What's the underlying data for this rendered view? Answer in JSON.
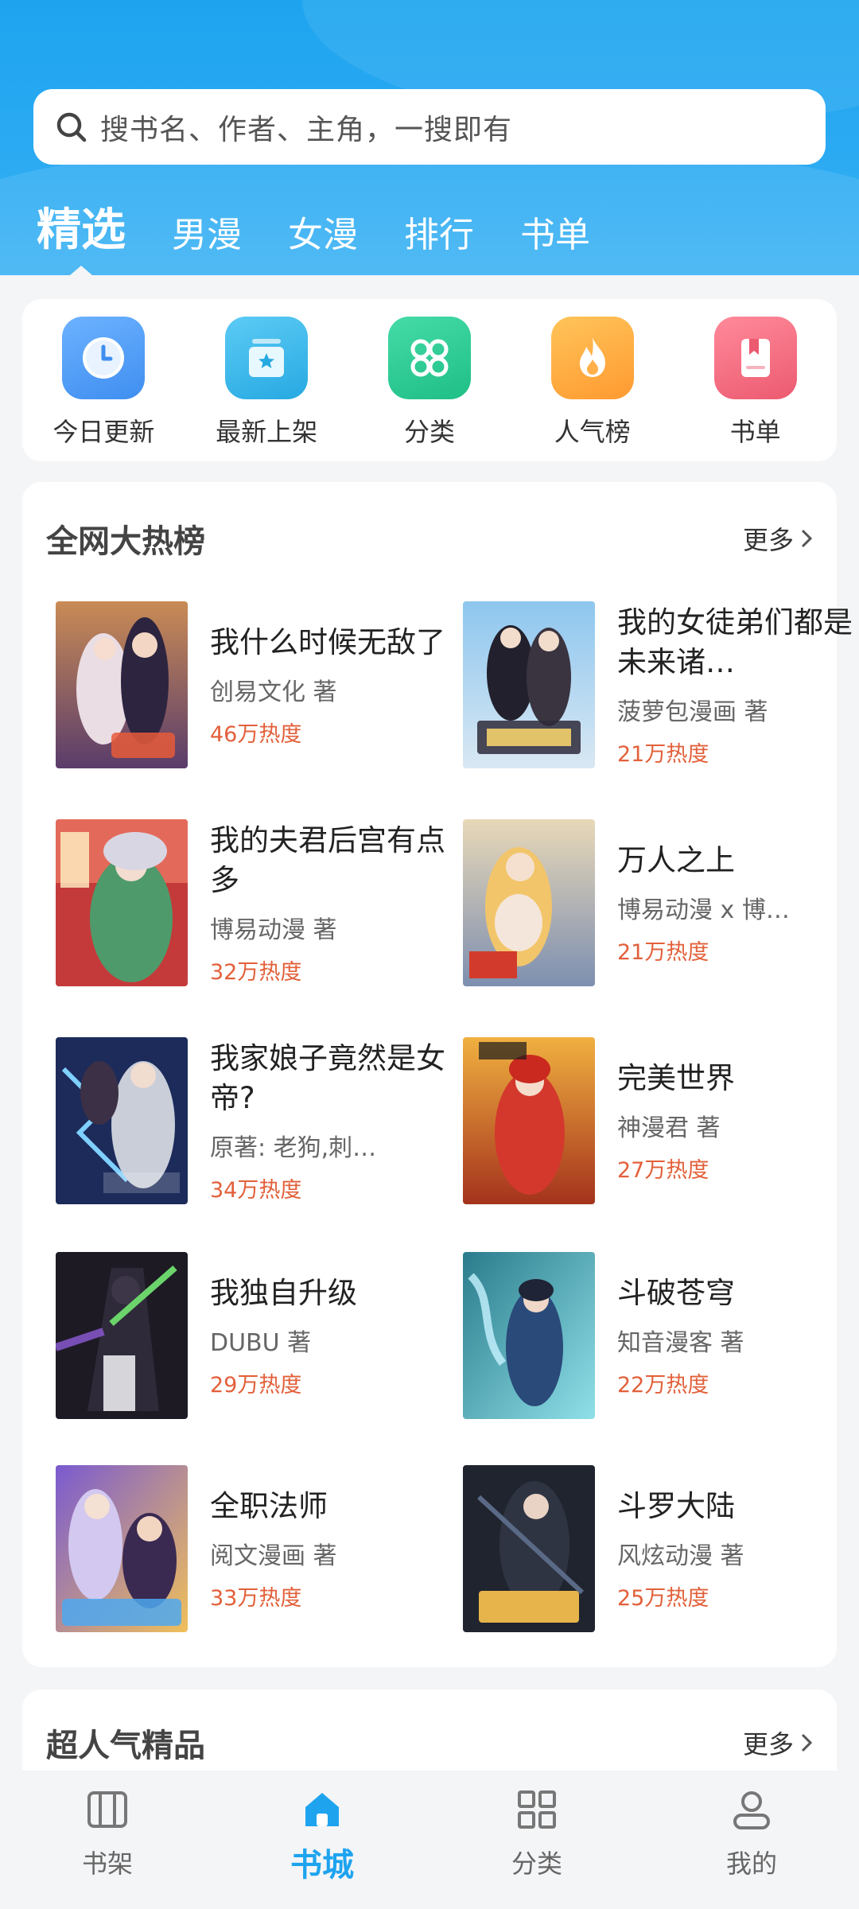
{
  "colors": {
    "accent": "#1ea4ef",
    "heat": "#e2603a",
    "background": "#f4f5f7"
  },
  "search": {
    "placeholder": "搜书名、作者、主角，一搜即有",
    "icon": "search-icon"
  },
  "tabs": [
    {
      "label": "精选",
      "active": true
    },
    {
      "label": "男漫"
    },
    {
      "label": "女漫"
    },
    {
      "label": "排行"
    },
    {
      "label": "书单"
    }
  ],
  "quick_links": [
    {
      "label": "今日更新",
      "icon": "clock-icon",
      "color": "#4a9af5"
    },
    {
      "label": "最新上架",
      "icon": "new-shelf-icon",
      "color": "#35b9ea"
    },
    {
      "label": "分类",
      "icon": "category-icon",
      "color": "#2ecc94"
    },
    {
      "label": "人气榜",
      "icon": "fire-icon",
      "color": "#ffa43a"
    },
    {
      "label": "书单",
      "icon": "booklist-icon",
      "color": "#f06a7e"
    }
  ],
  "hot_section": {
    "title": "全网大热榜",
    "more": "更多",
    "books": [
      {
        "title": "我什么时候无敌了",
        "author": "创易文化 著",
        "heat": "46万热度"
      },
      {
        "title": "我的女徒弟们都是未来诸…",
        "author": "菠萝包漫画 著",
        "heat": "21万热度"
      },
      {
        "title": "我的夫君后宫有点多",
        "author": "博易动漫 著",
        "heat": "32万热度"
      },
      {
        "title": "万人之上",
        "author": "博易动漫 x 博…",
        "heat": "21万热度"
      },
      {
        "title": "我家娘子竟然是女帝?",
        "author": "原著: 老狗,刺…",
        "heat": "34万热度"
      },
      {
        "title": "完美世界",
        "author": "神漫君 著",
        "heat": "27万热度"
      },
      {
        "title": "我独自升级",
        "author": "DUBU 著",
        "heat": "29万热度"
      },
      {
        "title": "斗破苍穹",
        "author": "知音漫客 著",
        "heat": "22万热度"
      },
      {
        "title": "全职法师",
        "author": "阅文漫画 著",
        "heat": "33万热度"
      },
      {
        "title": "斗罗大陆",
        "author": "风炫动漫 著",
        "heat": "25万热度"
      }
    ]
  },
  "popular_section": {
    "title": "超人气精品",
    "more": "更多"
  },
  "bottom_nav": [
    {
      "label": "书架",
      "icon": "bookshelf-icon"
    },
    {
      "label": "书城",
      "icon": "bookstore-home-icon",
      "active": true
    },
    {
      "label": "分类",
      "icon": "category-grid-icon"
    },
    {
      "label": "我的",
      "icon": "profile-icon"
    }
  ]
}
